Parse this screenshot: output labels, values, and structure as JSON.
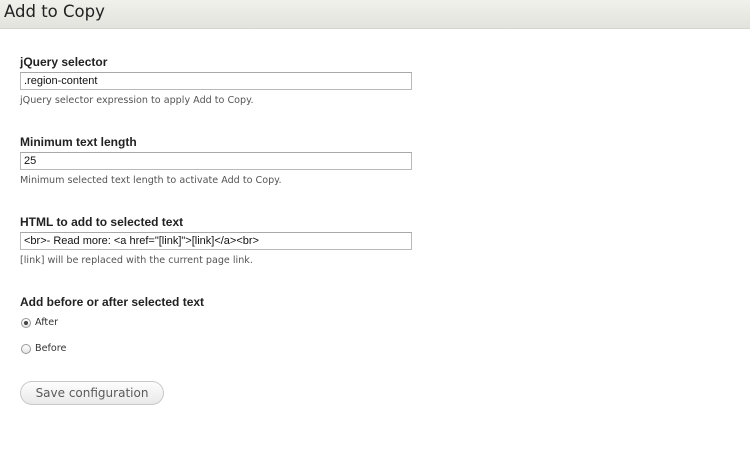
{
  "header": {
    "title": "Add to Copy"
  },
  "fields": {
    "selector": {
      "label": "jQuery selector",
      "value": ".region-content",
      "description": "jQuery selector expression to apply Add to Copy."
    },
    "min_length": {
      "label": "Minimum text length",
      "value": "25",
      "description": "Minimum selected text length to activate Add to Copy."
    },
    "html": {
      "label": "HTML to add to selected text",
      "value": "<br>- Read more: <a href=\"[link]\">[link]</a><br>",
      "description": "[link] will be replaced with the current page link."
    }
  },
  "position": {
    "label": "Add before or after selected text",
    "options": [
      {
        "label": "After",
        "checked": true
      },
      {
        "label": "Before",
        "checked": false
      }
    ]
  },
  "actions": {
    "save_label": "Save configuration"
  }
}
